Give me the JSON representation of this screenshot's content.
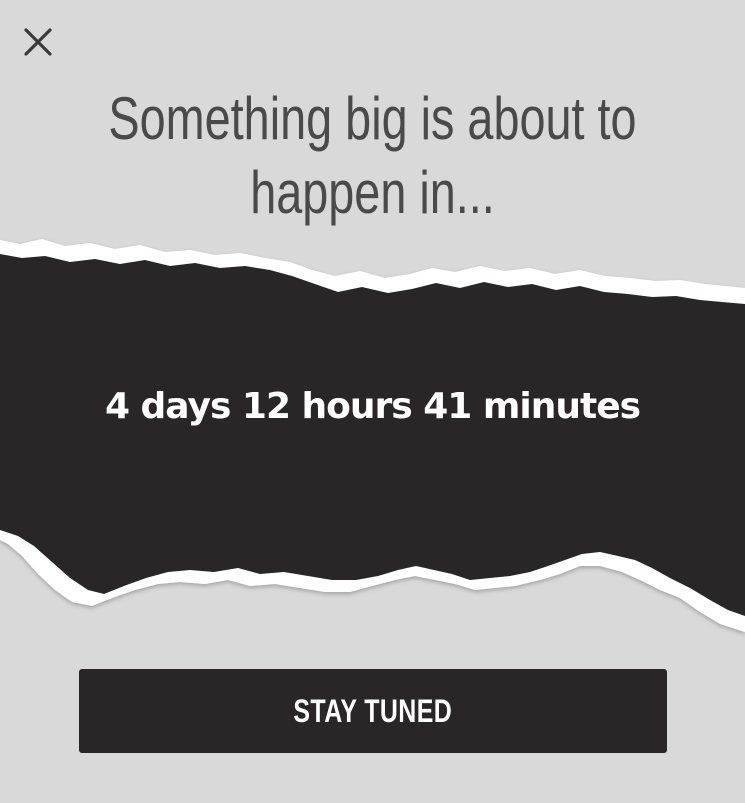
{
  "modal": {
    "close_icon": "close-icon",
    "headline": "Something big is about to happen in...",
    "countdown": "4 days 12 hours 41 minutes",
    "cta_label": "STAY TUNED"
  },
  "colors": {
    "background": "#d9d9d9",
    "band": "#2a2628",
    "paper_edge": "#ffffff",
    "headline_text": "#4a4a4a",
    "button": "#2a2628",
    "button_text": "#ffffff"
  }
}
